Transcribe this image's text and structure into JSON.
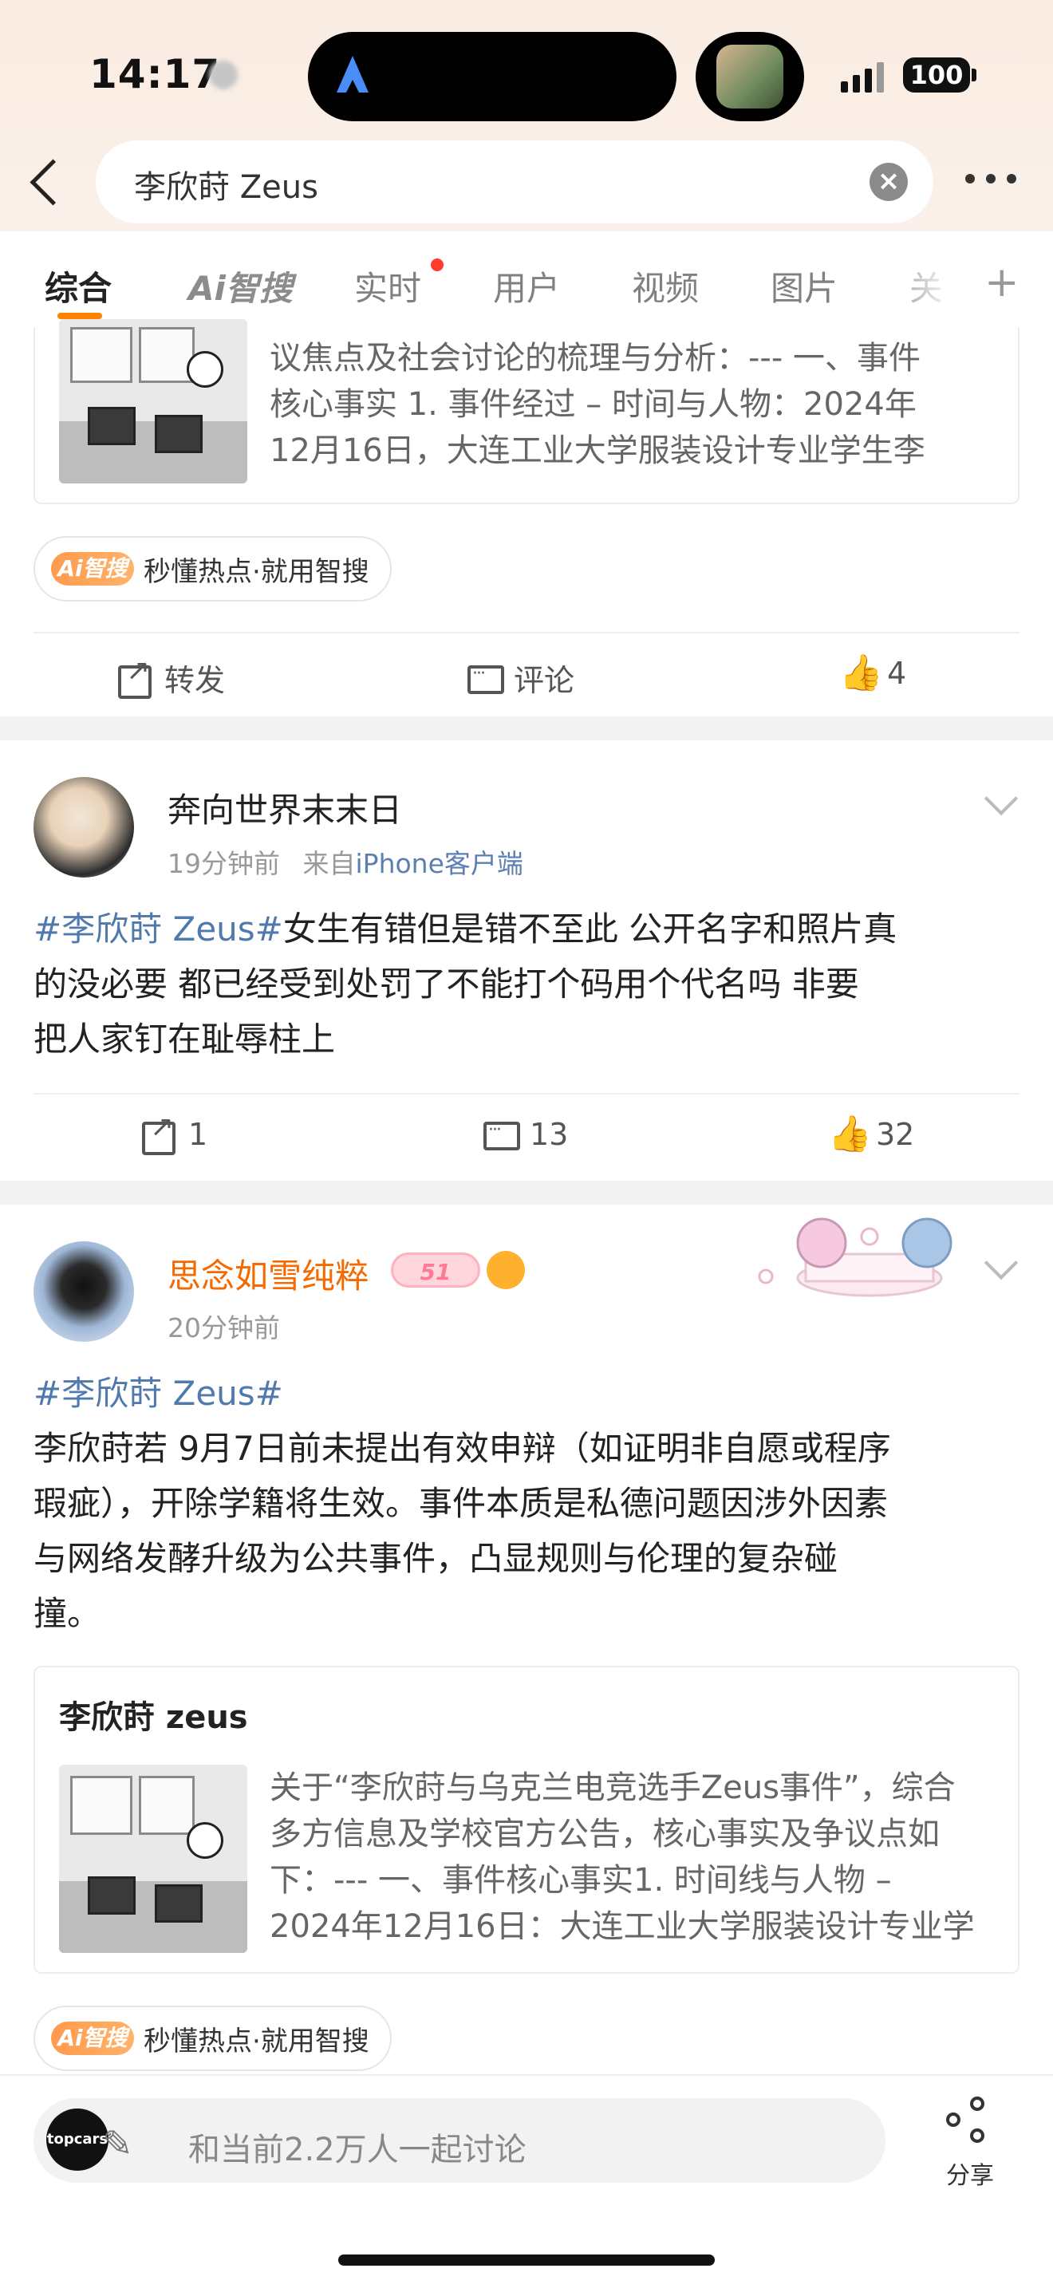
{
  "status_bar": {
    "time": "14:17",
    "battery": "100"
  },
  "search": {
    "query": "李欣莳 Zeus"
  },
  "tabs": [
    {
      "label": "综合",
      "active": true
    },
    {
      "label": "Ai智搜"
    },
    {
      "label": "实时",
      "badge": true
    },
    {
      "label": "用户"
    },
    {
      "label": "视频"
    },
    {
      "label": "图片"
    },
    {
      "label": "关"
    }
  ],
  "posts": [
    {
      "card": {
        "excerpt_lines": [
          "议焦点及社会讨论的梳理与分析：--- 一、事件",
          "核心事实  1. 事件经过      – 时间与人物：2024年",
          "12月16日，大连工业大学服装设计专业学生李"
        ]
      },
      "ai_pill": {
        "badge": "Ai智搜",
        "text": "秒懂热点·就用智搜"
      },
      "actions": {
        "repost": "转发",
        "comment": "评论",
        "likes": "4"
      }
    },
    {
      "user": "奔向世界末末日",
      "time": "19分钟前",
      "source_prefix": "来自",
      "source": "iPhone客户端",
      "text_lines": [
        {
          "topic": "#李欣莳 Zeus#",
          "text": "女生有错但是错不至此  公开名字和照片真"
        },
        {
          "text": "的没必要  都已经受到处罚了不能打个码用个代名吗  非要"
        },
        {
          "text": "把人家钉在耻辱柱上"
        }
      ],
      "actions": {
        "reposts": "1",
        "comments": "13",
        "likes": "32"
      }
    },
    {
      "user": "思念如雪纯粹",
      "level": "51",
      "time": "20分钟前",
      "topic": "#李欣莳 Zeus#",
      "text_lines": [
        "李欣莳若 9月7日前未提出有效申辩（如证明非自愿或程序",
        "瑕疵），开除学籍将生效。事件本质是私德问题因涉外因素",
        "与网络发酵升级为公共事件，凸显规则与伦理的复杂碰",
        "撞。"
      ],
      "card": {
        "title": "李欣莳 zeus",
        "excerpt_lines": [
          "关于“李欣莳与乌克兰电竞选手Zeus事件”，综合",
          "多方信息及学校官方公告，核心事实及争议点如",
          "下：--- 一、事件核心事实1. 时间线与人物      –",
          "2024年12月16日：大连工业大学服装设计专业学"
        ]
      },
      "ai_pill": {
        "badge": "Ai智搜",
        "text": "秒懂热点·就用智搜"
      }
    }
  ],
  "bottom": {
    "avatar_text": "topcars",
    "discuss_placeholder": "和当前2.2万人一起讨论",
    "share_label": "分享"
  },
  "colors": {
    "accent": "#ff8200",
    "topic": "#5079ad",
    "username_orange": "#f56a00"
  }
}
